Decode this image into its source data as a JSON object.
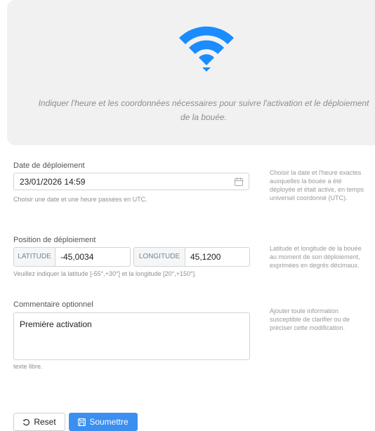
{
  "hero": {
    "description": "Indiquer l'heure et les coordonnées nécessaires pour suivre l'activation et le déploiement de la bouée.",
    "icon": "wifi-icon",
    "icon_color": "#1a8cff"
  },
  "deploy_date": {
    "label": "Date de déploiement",
    "value": "23/01/2026 14:59",
    "help": "Choisir une date et une heure passées en UTC.",
    "side": "Choisir la date et l'heure exactes auxquelles la bouée a été déployée et était active, en temps universel coordonné (UTC)."
  },
  "position": {
    "label": "Position de déploiement",
    "latitude_label": "LATITUDE",
    "latitude_value": "-45,0034",
    "longitude_label": "LONGITUDE",
    "longitude_value": "45,1200",
    "help": "Veuillez indiquer la latitude [-55°,+30°] et la longitude [20°,+150°].",
    "side": "Latitude et longitude de la bouée au moment de son déploiement, exprimées en degrés décimaux."
  },
  "comment": {
    "label": "Commentaire optionnel",
    "value": "Première activation",
    "help": "texte libre.",
    "side": "Ajouter toute information susceptible de clarifier ou de préciser cette modification."
  },
  "actions": {
    "reset_label": "Reset",
    "submit_label": "Soumettre",
    "submit_color": "#3a8ff0"
  }
}
